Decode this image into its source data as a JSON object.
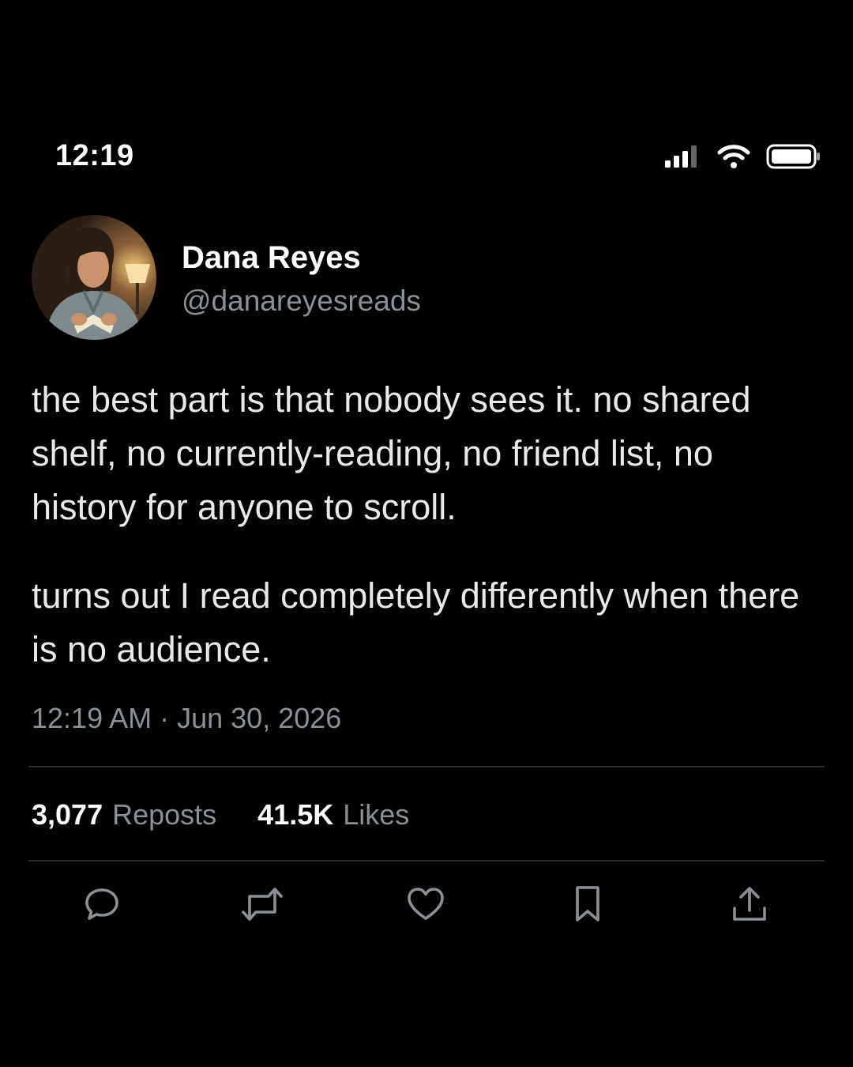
{
  "status_bar": {
    "time": "12:19",
    "icons": [
      "cellular-signal-icon",
      "wifi-icon",
      "battery-icon"
    ]
  },
  "author": {
    "display_name": "Dana Reyes",
    "handle": "@danareyesreads"
  },
  "post": {
    "paragraphs": [
      "the best part is that nobody sees it. no shared shelf, no currently-reading, no friend list, no history for anyone to scroll.",
      "turns out I read completely differently when there is no audience."
    ],
    "time": "12:19 AM",
    "separator": "·",
    "date": "Jun 30, 2026"
  },
  "stats": {
    "reposts_count": "3,077",
    "reposts_label": "Reposts",
    "likes_count": "41.5K",
    "likes_label": "Likes"
  },
  "actions": [
    "reply-icon",
    "repost-icon",
    "like-icon",
    "bookmark-icon",
    "share-icon"
  ],
  "colors": {
    "background": "#000000",
    "primary_text": "#e7e9ea",
    "secondary_text": "#8b9096",
    "divider": "#2a2d31"
  }
}
